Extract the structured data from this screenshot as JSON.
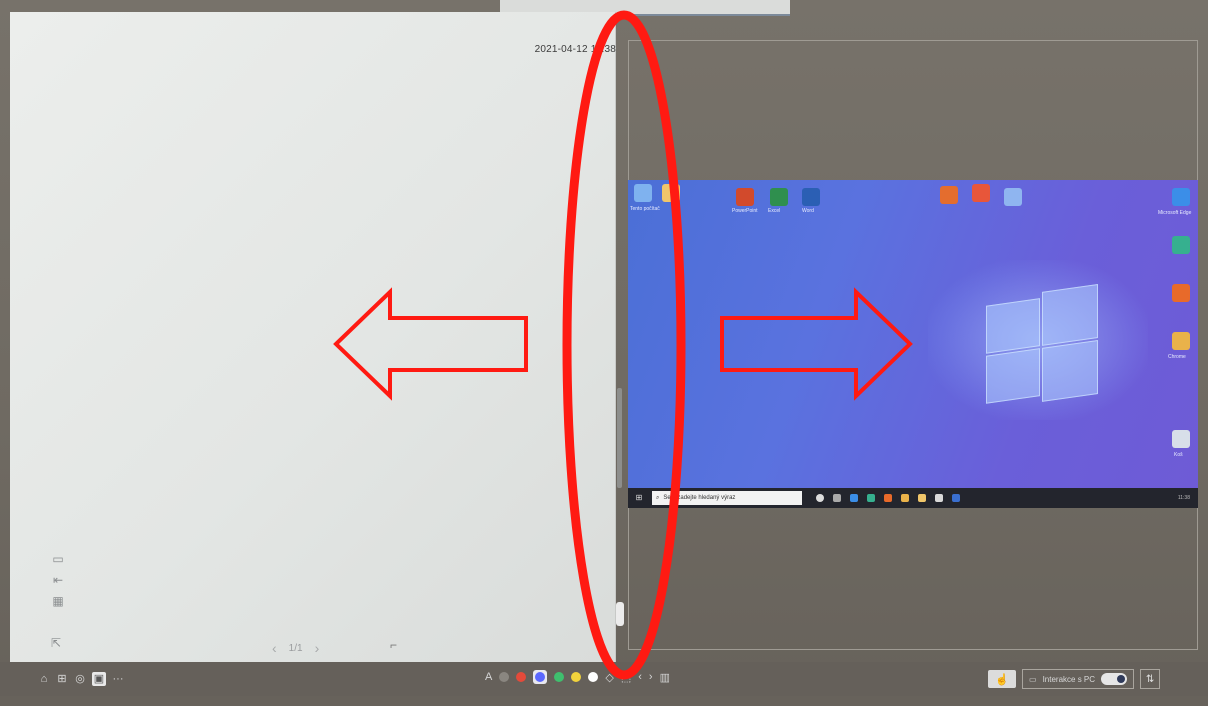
{
  "whiteboard": {
    "timestamp": "2021-04-12 11:38",
    "pager": {
      "prev_icon": "chevron-left-icon",
      "page": "1/1",
      "next_icon": "chevron-right-icon"
    },
    "side_tools": [
      "folder-icon",
      "export-icon",
      "qr-code-icon"
    ],
    "bottom_left_icon": "share-icon",
    "crop_icon": "crop-icon"
  },
  "desktop": {
    "search_placeholder": "Sem zadejte hledaný výraz",
    "icons_left": [
      "Tento počítač"
    ],
    "icons_apps": [
      "PowerPoint",
      "Excel",
      "Word"
    ],
    "icons_right": [
      "Microsoft Edge",
      "Chrome",
      "Koš"
    ],
    "taskbar_time": "11:38"
  },
  "bottom_toolbar": {
    "left_icons": [
      "home-icon",
      "grid-icon",
      "camera-icon",
      "whiteboard-icon",
      "more-icon"
    ],
    "more_label": "···",
    "pen_colors": [
      "#e44a3a",
      "#5a67ff",
      "#3fbf6e",
      "#f2d33c",
      "#ffffff"
    ],
    "interaction_label": "Interakce s PC",
    "toggle_state": "ON"
  },
  "colors": {
    "annotation_red": "#ff1a12",
    "desktop_blue": "#4b6fd6",
    "whiteboard_bg": "#e6e8e6"
  }
}
